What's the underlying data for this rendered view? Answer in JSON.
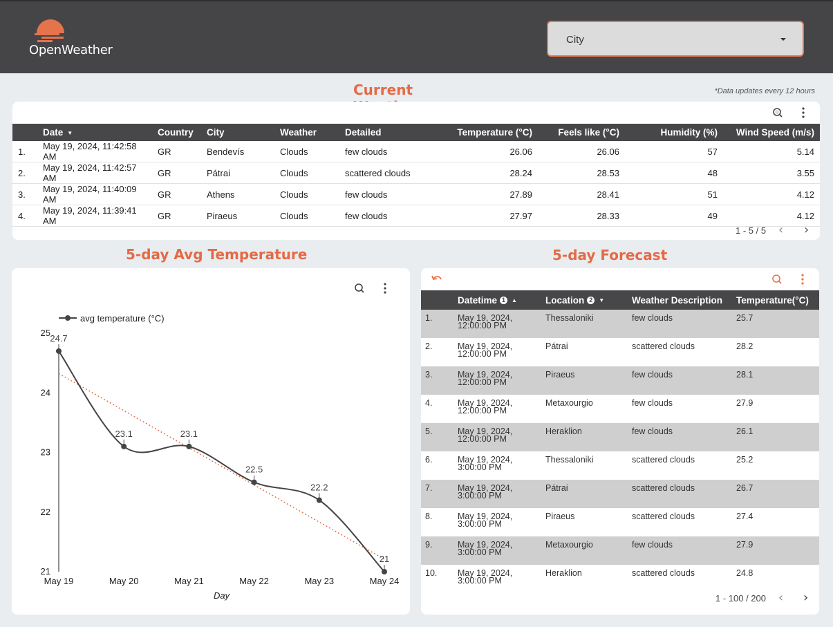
{
  "header": {
    "logo_text": "OpenWeather",
    "city_filter": {
      "label": "City"
    }
  },
  "current_weather": {
    "title_line1": "Current",
    "title_line2": "Weather",
    "note": "*Data updates every 12 hours",
    "columns": [
      "Date",
      "Country",
      "City",
      "Weather",
      "Detailed",
      "Temperature (°C)",
      "Feels like (°C)",
      "Humidity (%)",
      "Wind Speed (m/s)"
    ],
    "rows": [
      {
        "n": "1.",
        "date": "May 19, 2024, 11:42:58 AM",
        "country": "GR",
        "city": "Bendevís",
        "weather": "Clouds",
        "detailed": "few clouds",
        "temp": "26.06",
        "feels": "26.06",
        "humidity": "57",
        "wind": "5.14"
      },
      {
        "n": "2.",
        "date": "May 19, 2024, 11:42:57 AM",
        "country": "GR",
        "city": "Pátrai",
        "weather": "Clouds",
        "detailed": "scattered clouds",
        "temp": "28.24",
        "feels": "28.53",
        "humidity": "48",
        "wind": "3.55"
      },
      {
        "n": "3.",
        "date": "May 19, 2024, 11:40:09 AM",
        "country": "GR",
        "city": "Athens",
        "weather": "Clouds",
        "detailed": "few clouds",
        "temp": "27.89",
        "feels": "28.41",
        "humidity": "51",
        "wind": "4.12"
      },
      {
        "n": "4.",
        "date": "May 19, 2024, 11:39:41 AM",
        "country": "GR",
        "city": "Piraeus",
        "weather": "Clouds",
        "detailed": "few clouds",
        "temp": "27.97",
        "feels": "28.33",
        "humidity": "49",
        "wind": "4.12"
      }
    ],
    "pagination": "1 - 5 / 5"
  },
  "avg_temp": {
    "title": "5-day Avg Temperature"
  },
  "forecast": {
    "title": "5-day Forecast",
    "columns": [
      "Datetime",
      "Location",
      "Weather Description",
      "Temperature(°C)"
    ],
    "info_marks": [
      "1",
      "2"
    ],
    "rows": [
      {
        "n": "1.",
        "dt1": "May 19, 2024,",
        "dt2": "12:00:00 PM",
        "loc": "Thessaloniki",
        "desc": "few clouds",
        "temp": "25.7"
      },
      {
        "n": "2.",
        "dt1": "May 19, 2024,",
        "dt2": "12:00:00 PM",
        "loc": "Pátrai",
        "desc": "scattered clouds",
        "temp": "28.2"
      },
      {
        "n": "3.",
        "dt1": "May 19, 2024,",
        "dt2": "12:00:00 PM",
        "loc": "Piraeus",
        "desc": "few clouds",
        "temp": "28.1"
      },
      {
        "n": "4.",
        "dt1": "May 19, 2024,",
        "dt2": "12:00:00 PM",
        "loc": "Metaxourgio",
        "desc": "few clouds",
        "temp": "27.9"
      },
      {
        "n": "5.",
        "dt1": "May 19, 2024,",
        "dt2": "12:00:00 PM",
        "loc": "Heraklion",
        "desc": "few clouds",
        "temp": "26.1"
      },
      {
        "n": "6.",
        "dt1": "May 19, 2024,",
        "dt2": "3:00:00 PM",
        "loc": "Thessaloniki",
        "desc": "scattered clouds",
        "temp": "25.2"
      },
      {
        "n": "7.",
        "dt1": "May 19, 2024,",
        "dt2": "3:00:00 PM",
        "loc": "Pátrai",
        "desc": "scattered clouds",
        "temp": "26.7"
      },
      {
        "n": "8.",
        "dt1": "May 19, 2024,",
        "dt2": "3:00:00 PM",
        "loc": "Piraeus",
        "desc": "scattered clouds",
        "temp": "27.4"
      },
      {
        "n": "9.",
        "dt1": "May 19, 2024,",
        "dt2": "3:00:00 PM",
        "loc": "Metaxourgio",
        "desc": "few clouds",
        "temp": "27.9"
      },
      {
        "n": "10.",
        "dt1": "May 19, 2024,",
        "dt2": "3:00:00 PM",
        "loc": "Heraklion",
        "desc": "scattered clouds",
        "temp": "24.8"
      }
    ],
    "pagination": "1 - 100 / 200"
  },
  "icons": {
    "zoom": "zoom-icon",
    "more": "more-vert-icon",
    "undo": "undo-icon",
    "prev": "chevron-left-icon",
    "next": "chevron-right-icon"
  },
  "colors": {
    "accent": "#e46a46",
    "header_bg": "#454547",
    "table_header": "#474749",
    "trend": "#e5734c",
    "series": "#444444"
  },
  "chart_data": {
    "type": "line",
    "categories": [
      "May 19",
      "May 20",
      "May 21",
      "May 22",
      "May 23",
      "May 24"
    ],
    "series": [
      {
        "name": "avg temperature (°C)",
        "values": [
          24.7,
          23.1,
          23.1,
          22.5,
          22.2,
          21
        ]
      }
    ],
    "value_labels": [
      "24.7",
      "23.1",
      "23.1",
      "22.5",
      "22.2",
      "21"
    ],
    "trendline": true,
    "xlabel": "Day",
    "ylabel": "",
    "ylim": [
      21,
      25
    ],
    "yticks": [
      21,
      22,
      23,
      24,
      25
    ],
    "grid": false,
    "legend": "top-left"
  }
}
